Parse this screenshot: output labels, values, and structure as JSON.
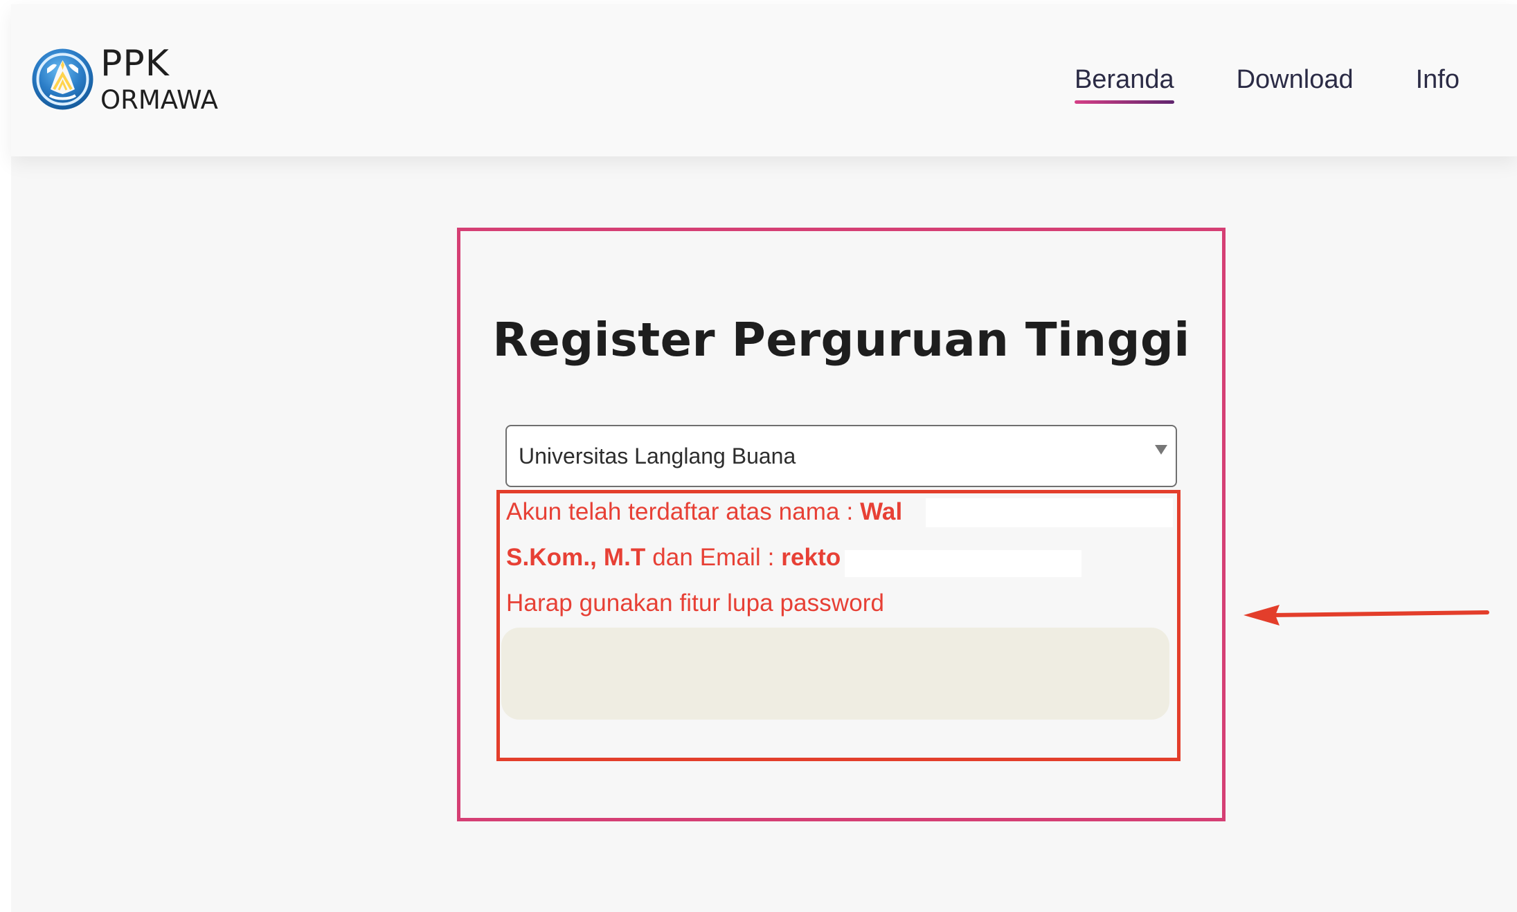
{
  "brand": {
    "line1": "PPK",
    "line2": "ORMAWA"
  },
  "nav": {
    "items": [
      {
        "label": "Beranda"
      },
      {
        "label": "Download"
      },
      {
        "label": "Info"
      }
    ]
  },
  "form": {
    "title": "Register Perguruan Tinggi",
    "selected_university": "Universitas Langlang Buana"
  },
  "alert": {
    "line1_prefix": "Akun telah terdaftar atas nama : ",
    "line1_name_visible": "Wal",
    "line2_name_visible": "S.Kom., M.T",
    "line2_email_label": " dan Email : ",
    "line2_email_visible": "rekto",
    "line3": "Harap gunakan fitur lupa password"
  },
  "colors": {
    "brand_pink": "#d53f74",
    "alert_red": "#e33e2b",
    "nav_text": "#2b2b45",
    "message_panel": "#efede2"
  },
  "icons": {
    "logo": "university-emblem-icon",
    "dropdown": "caret-down-icon",
    "pointer": "arrow-left-icon"
  }
}
